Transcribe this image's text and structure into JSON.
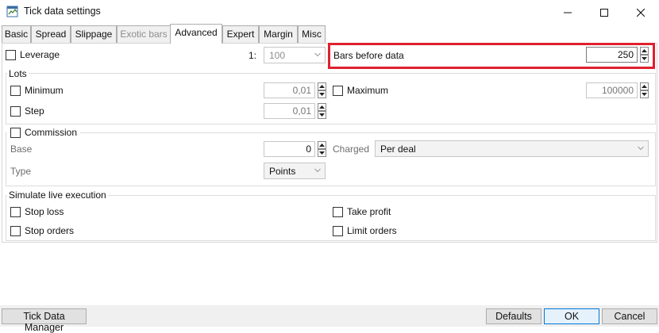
{
  "window": {
    "title": "Tick data settings"
  },
  "tabs": [
    {
      "label": "Basic"
    },
    {
      "label": "Spread"
    },
    {
      "label": "Slippage"
    },
    {
      "label": "Exotic bars"
    },
    {
      "label": "Advanced"
    },
    {
      "label": "Expert"
    },
    {
      "label": "Margin"
    },
    {
      "label": "Misc"
    }
  ],
  "leverage": {
    "label": "Leverage",
    "prefix": "1:",
    "value": "100"
  },
  "bars_before_data": {
    "label": "Bars before data",
    "value": "250"
  },
  "lots": {
    "title": "Lots",
    "minimum": {
      "label": "Minimum",
      "value": "0,01"
    },
    "maximum": {
      "label": "Maximum",
      "value": "100000"
    },
    "step": {
      "label": "Step",
      "value": "0,01"
    }
  },
  "commission": {
    "title": "Commission",
    "base": {
      "label": "Base",
      "value": "0"
    },
    "charged": {
      "label": "Charged",
      "value": "Per deal"
    },
    "type": {
      "label": "Type",
      "value": "Points"
    }
  },
  "simulate": {
    "title": "Simulate live execution",
    "stop_loss": "Stop loss",
    "take_profit": "Take profit",
    "stop_orders": "Stop orders",
    "limit_orders": "Limit orders"
  },
  "footer": {
    "tick_data_manager": "Tick Data Manager",
    "defaults": "Defaults",
    "ok": "OK",
    "cancel": "Cancel"
  },
  "colors": {
    "highlight": "#e0202e",
    "focus": "#0078d7"
  }
}
